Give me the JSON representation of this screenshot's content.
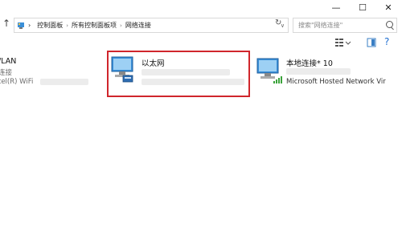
{
  "window": {
    "minimize_glyph": "—",
    "maximize_glyph": "☐",
    "close_glyph": "✕"
  },
  "address": {
    "crumbs": [
      "控制面板",
      "所有控制面板项",
      "网络连接"
    ],
    "separator": "›"
  },
  "search": {
    "placeholder": "搜索\"网络连接\""
  },
  "connections": [
    {
      "name": "/LAN",
      "status": "连接",
      "adapter": "tel(R) WiFi"
    },
    {
      "name": "以太网",
      "status": "",
      "adapter": ""
    },
    {
      "name": "本地连接* 10",
      "status": "",
      "adapter": "Microsoft Hosted Network Vir"
    }
  ],
  "colors": {
    "highlight_border": "#d0262c",
    "address_border": "#d9d9d9",
    "background": "#ffffff"
  }
}
